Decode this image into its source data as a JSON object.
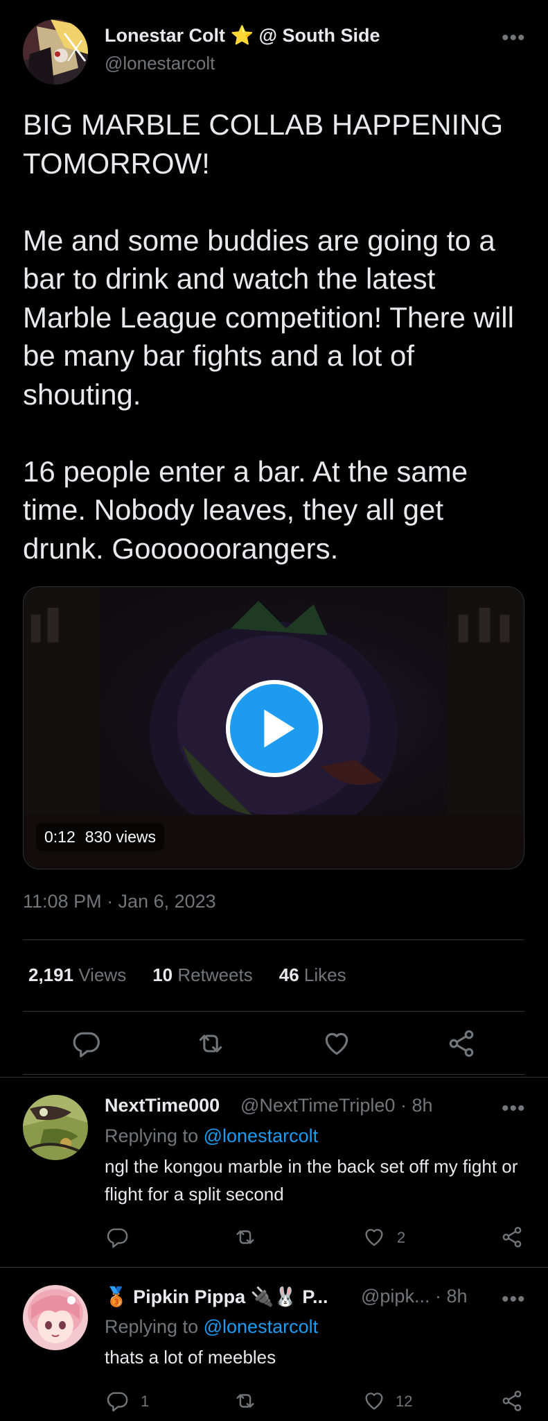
{
  "tweet": {
    "author_name": "Lonestar Colt",
    "author_star": "⭐",
    "author_location": "@ South Side",
    "author_handle": "@lonestarcolt",
    "more_label": "•••",
    "text": "BIG MARBLE COLLAB HAPPENING TOMORROW!\n\nMe and some buddies are going to a bar to drink and watch the latest Marble League competition! There will be many bar fights and a lot of shouting.\n\n16 people enter a bar. At the same time. Nobody leaves, they all get drunk. Goooooorangers.",
    "video": {
      "duration": "0:12",
      "views": "830 views"
    },
    "timestamp": "11:08 PM · Jan 6, 2023",
    "metrics": [
      {
        "num": "2,191",
        "label": "Views"
      },
      {
        "num": "10",
        "label": "Retweets"
      },
      {
        "num": "46",
        "label": "Likes"
      }
    ]
  },
  "replies": [
    {
      "name": "NextTime000",
      "handle": "@NextTimeTriple0 · 8h",
      "replying_prefix": "Replying to",
      "replying_to": "@lonestarcolt",
      "text": "ngl the kongou marble in the back set off my fight or flight for a split second",
      "reply_count": "",
      "like_count": "2"
    },
    {
      "name": "Pipkin Pippa",
      "name_prefix": "🥉",
      "name_suffix": "🔌🐰 P...",
      "handle": "@pipk... · 8h",
      "replying_prefix": "Replying to",
      "replying_to": "@lonestarcolt",
      "text": "thats a lot of meebles",
      "reply_count": "1",
      "like_count": "12"
    }
  ],
  "colors": {
    "accent": "#1d9bf0",
    "muted": "#71767b",
    "divider": "#2f3336",
    "star": "#f7b500"
  }
}
